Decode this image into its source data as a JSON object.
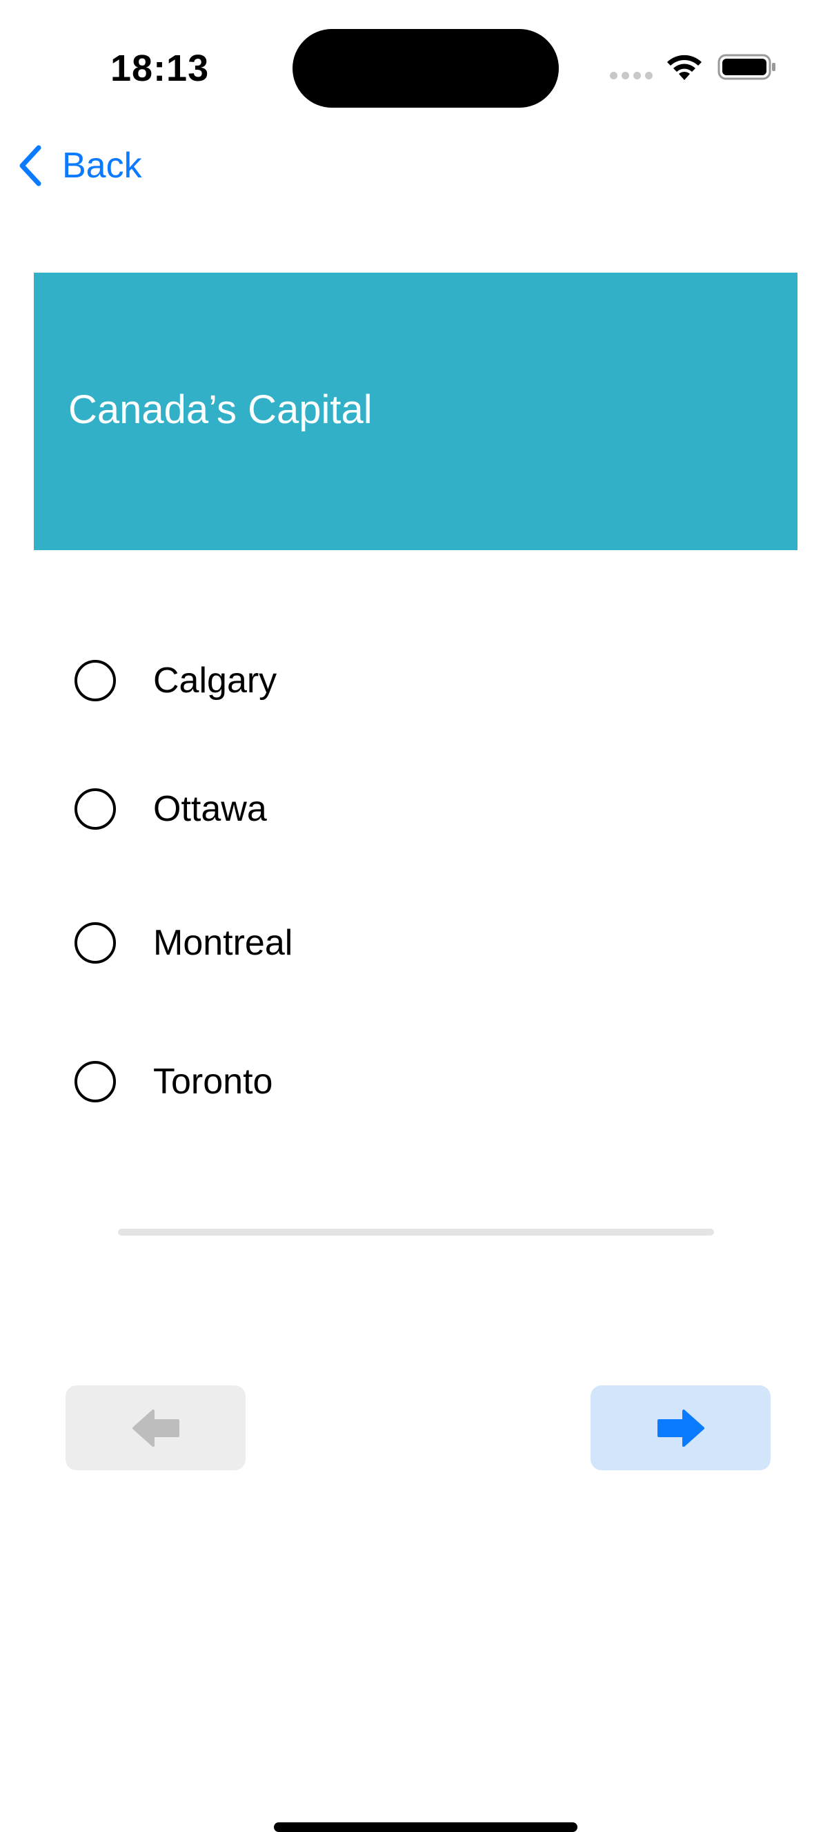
{
  "status_bar": {
    "time": "18:13"
  },
  "nav": {
    "back_label": "Back"
  },
  "question": {
    "title": "Canada’s Capital"
  },
  "options": [
    {
      "label": "Calgary",
      "selected": false
    },
    {
      "label": "Ottawa",
      "selected": false
    },
    {
      "label": "Montreal",
      "selected": false
    },
    {
      "label": "Toronto",
      "selected": false
    }
  ],
  "progress": {
    "fraction": 0
  },
  "buttons": {
    "previous": {
      "icon": "arrow-left-icon",
      "enabled": false
    },
    "next": {
      "icon": "arrow-right-icon",
      "enabled": true
    }
  },
  "colors": {
    "accent": "#0a7aff",
    "header_background": "#31b0c8",
    "header_text": "#ffffff",
    "disabled_button_background": "#ededed",
    "disabled_icon": "#bdbdbd",
    "next_button_background": "#d3e5fb"
  }
}
